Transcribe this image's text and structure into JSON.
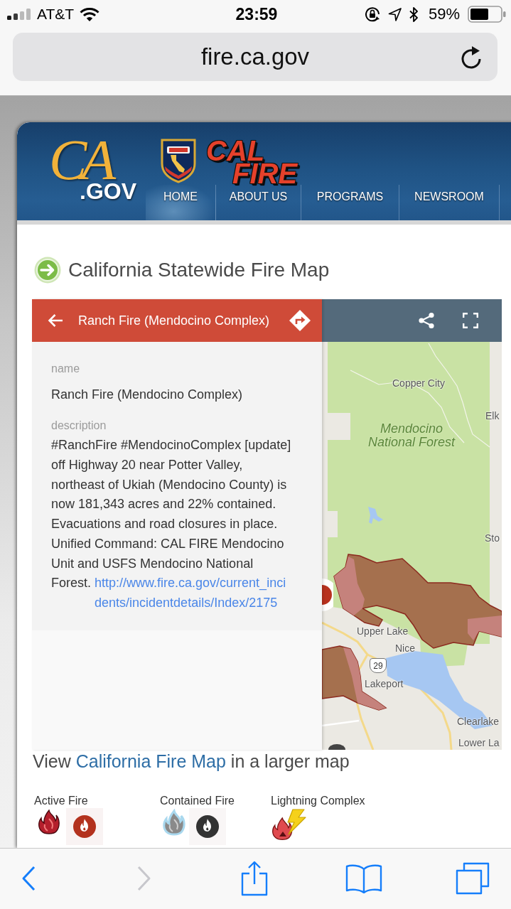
{
  "status_bar": {
    "carrier": "AT&T",
    "time": "23:59",
    "battery": "59%"
  },
  "address_bar": {
    "url": "fire.ca.gov"
  },
  "site_header": {
    "logo": {
      "script": "CA",
      "suffix": ".GOV"
    },
    "brand_lines": [
      "CAL",
      "FIRE"
    ],
    "nav": [
      {
        "label": "HOME",
        "selected": true
      },
      {
        "label": "ABOUT US",
        "selected": false
      },
      {
        "label": "PROGRAMS",
        "selected": false
      },
      {
        "label": "NEWSROOM",
        "selected": false
      }
    ]
  },
  "page_title": "California Statewide Fire Map",
  "map_embed": {
    "panel": {
      "title": "Ranch Fire (Mendocino Complex)",
      "fields": [
        {
          "label": "name",
          "value": "Ranch Fire (Mendocino Complex)"
        },
        {
          "label": "description",
          "value": "#RanchFire #MendocinoComplex [update] off Highway 20 near Potter Valley, northeast of Ukiah (Mendocino County) is now 181,343 acres and 22% contained. Evacuations and road closures in place. Unified Command: CAL FIRE Mendocino Unit and USFS Mendocino National Forest.",
          "link": "http://www.fire.ca.gov/current_incidents/incidentdetails/Index/2175"
        }
      ]
    },
    "map_labels": [
      {
        "kind": "town",
        "text": "Copper City"
      },
      {
        "kind": "forest",
        "text": "Mendocino National Forest"
      },
      {
        "kind": "town",
        "text": "Elk"
      },
      {
        "kind": "town",
        "text": "Sto"
      },
      {
        "kind": "town",
        "text": "Upper Lake"
      },
      {
        "kind": "town",
        "text": "Nice"
      },
      {
        "kind": "highway",
        "text": "29"
      },
      {
        "kind": "town",
        "text": "Lakeport"
      },
      {
        "kind": "town",
        "text": "Clearlake"
      },
      {
        "kind": "town",
        "text": "Lower La"
      }
    ]
  },
  "larger_map_note": {
    "before": "View",
    "link": "California Fire Map",
    "after": "in a larger map"
  },
  "legend": [
    {
      "kind": "active",
      "label": "Active Fire"
    },
    {
      "kind": "contained",
      "label": "Contained Fire"
    },
    {
      "kind": "lightning",
      "label": "Lightning Complex"
    }
  ],
  "toolbar": [
    {
      "kind": "back",
      "disabled": false
    },
    {
      "kind": "forward",
      "disabled": true
    },
    {
      "kind": "share",
      "disabled": false
    },
    {
      "kind": "bookmarks",
      "disabled": false
    },
    {
      "kind": "tabs",
      "disabled": false
    }
  ]
}
